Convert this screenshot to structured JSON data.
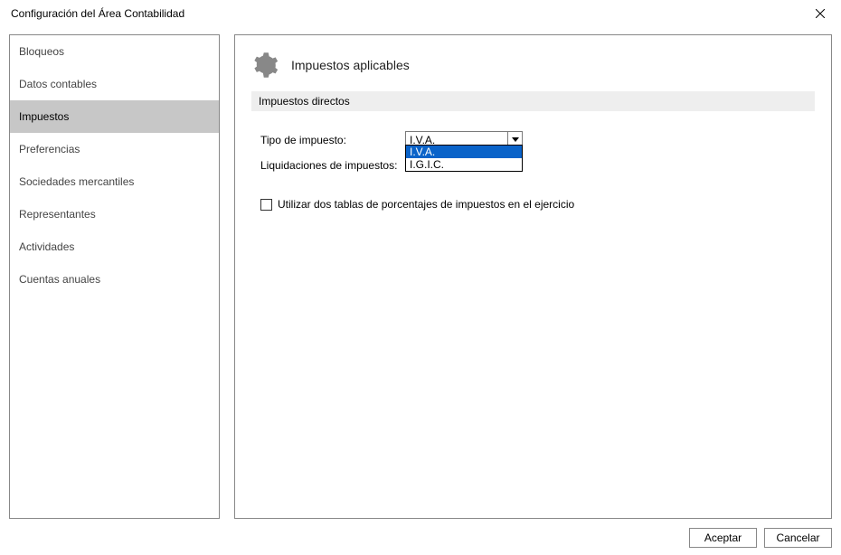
{
  "window": {
    "title": "Configuración del Área Contabilidad"
  },
  "sidebar": {
    "items": [
      {
        "label": "Bloqueos"
      },
      {
        "label": "Datos contables"
      },
      {
        "label": "Impuestos"
      },
      {
        "label": "Preferencias"
      },
      {
        "label": "Sociedades mercantiles"
      },
      {
        "label": "Representantes"
      },
      {
        "label": "Actividades"
      },
      {
        "label": "Cuentas anuales"
      }
    ],
    "selected_index": 2
  },
  "content": {
    "title": "Impuestos aplicables",
    "section_title": "Impuestos directos",
    "form": {
      "tipo_label": "Tipo de impuesto:",
      "tipo_value": "I.V.A.",
      "tipo_options": [
        "I.V.A.",
        "I.G.I.C."
      ],
      "tipo_highlighted_index": 0,
      "liquidaciones_label": "Liquidaciones de impuestos:",
      "checkbox_label": "Utilizar dos tablas de porcentajes de impuestos en el ejercicio",
      "checkbox_checked": false
    }
  },
  "buttons": {
    "accept": "Aceptar",
    "cancel": "Cancelar"
  }
}
